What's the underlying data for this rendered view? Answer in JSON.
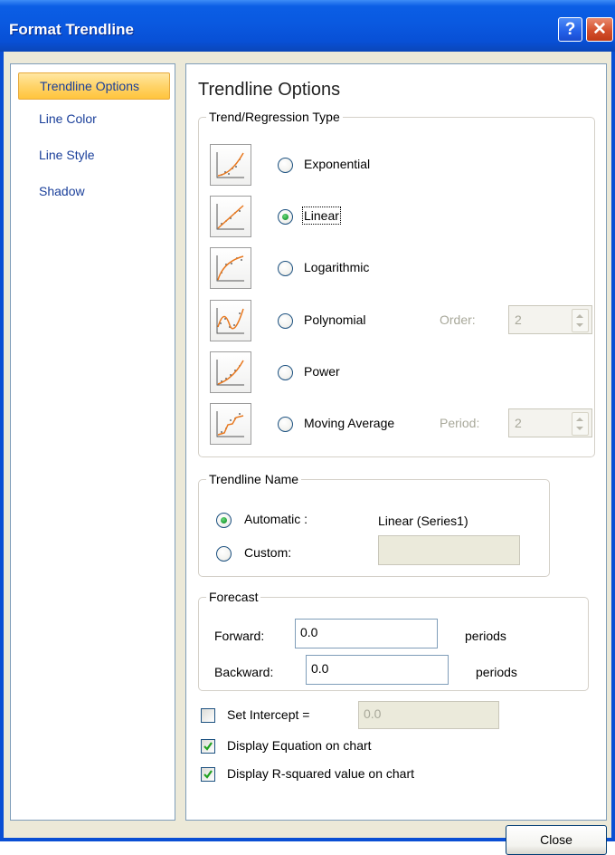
{
  "window": {
    "title": "Format Trendline",
    "help_glyph": "?",
    "close_glyph": "✕"
  },
  "sidebar": {
    "items": [
      {
        "label": "Trendline Options",
        "selected": true
      },
      {
        "label": "Line Color"
      },
      {
        "label": "Line Style"
      },
      {
        "label": "Shadow"
      }
    ]
  },
  "options": {
    "title": "Trendline Options",
    "regression_group": "Trend/Regression Type",
    "types": [
      {
        "label": "Exponential",
        "icon": "exponential-trend-icon",
        "selected": false
      },
      {
        "label": "Linear",
        "icon": "linear-trend-icon",
        "selected": true
      },
      {
        "label": "Logarithmic",
        "icon": "logarithmic-trend-icon",
        "selected": false
      },
      {
        "label": "Polynomial",
        "icon": "polynomial-trend-icon",
        "selected": false
      },
      {
        "label": "Power",
        "icon": "power-trend-icon",
        "selected": false
      },
      {
        "label": "Moving Average",
        "icon": "moving-average-trend-icon",
        "selected": false
      }
    ],
    "order_label": "Order:",
    "order_value": "2",
    "period_label": "Period:",
    "period_value": "2",
    "name_group": "Trendline Name",
    "automatic_label": "Automatic :",
    "automatic_value": "Linear (Series1)",
    "custom_label": "Custom:",
    "custom_value": "",
    "forecast_group": "Forecast",
    "forward_label": "Forward:",
    "forward_value": "0.0",
    "backward_label": "Backward:",
    "backward_value": "0.0",
    "periods_label": "periods",
    "set_intercept_label": "Set Intercept =",
    "set_intercept_checked": false,
    "set_intercept_value": "0.0",
    "display_equation_label": "Display Equation on chart",
    "display_equation_checked": true,
    "display_rsquared_label": "Display R-squared value on chart",
    "display_rsquared_checked": true
  },
  "footer": {
    "close_label": "Close"
  },
  "colors": {
    "title_bar": "#0a59e0",
    "selection": "#ffd46a",
    "radio_dot": "#27a83e",
    "curve": "#e8781e"
  }
}
